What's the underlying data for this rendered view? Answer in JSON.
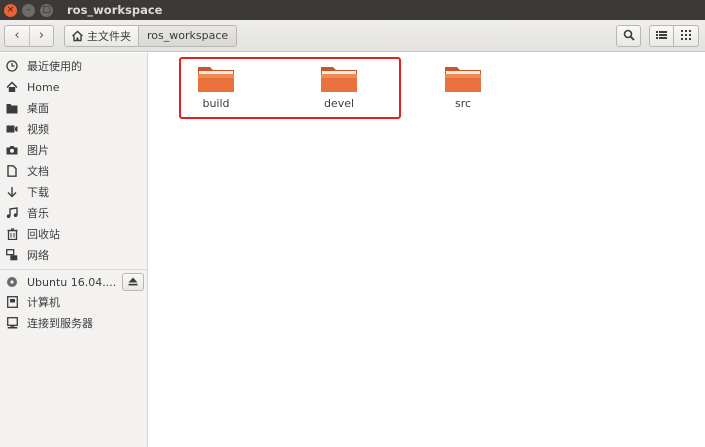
{
  "window": {
    "title": "ros_workspace",
    "controls": {
      "close": "×",
      "minimize": "–",
      "maximize": "□"
    }
  },
  "toolbar": {
    "back": "‹",
    "forward": "›",
    "breadcrumbs": [
      {
        "label": "主文件夹",
        "icon": "home-icon"
      },
      {
        "label": "ros_workspace"
      }
    ],
    "search_icon": "search-icon",
    "view_list_icon": "list-view-icon",
    "view_grid_icon": "grid-view-icon"
  },
  "sidebar": {
    "places": [
      {
        "label": "最近使用的",
        "icon": "clock-icon"
      },
      {
        "label": "Home",
        "icon": "home-icon"
      },
      {
        "label": "桌面",
        "icon": "folder-icon"
      },
      {
        "label": "视频",
        "icon": "video-icon"
      },
      {
        "label": "图片",
        "icon": "camera-icon"
      },
      {
        "label": "文档",
        "icon": "document-icon"
      },
      {
        "label": "下载",
        "icon": "download-icon"
      },
      {
        "label": "音乐",
        "icon": "music-icon"
      },
      {
        "label": "回收站",
        "icon": "trash-icon"
      },
      {
        "label": "网络",
        "icon": "network-icon"
      }
    ],
    "devices": [
      {
        "label": "Ubuntu 16.04....",
        "icon": "disc-icon",
        "eject": true
      },
      {
        "label": "计算机",
        "icon": "computer-icon"
      },
      {
        "label": "连接到服务器",
        "icon": "server-icon"
      }
    ]
  },
  "files": [
    {
      "name": "build",
      "icon": "folder-icon"
    },
    {
      "name": "devel",
      "icon": "folder-icon"
    },
    {
      "name": "src",
      "icon": "folder-icon"
    }
  ],
  "colors": {
    "titlebar": "#3b3a36",
    "close": "#e8623a",
    "folder": "#e9713d",
    "highlight": "#e3201b"
  }
}
